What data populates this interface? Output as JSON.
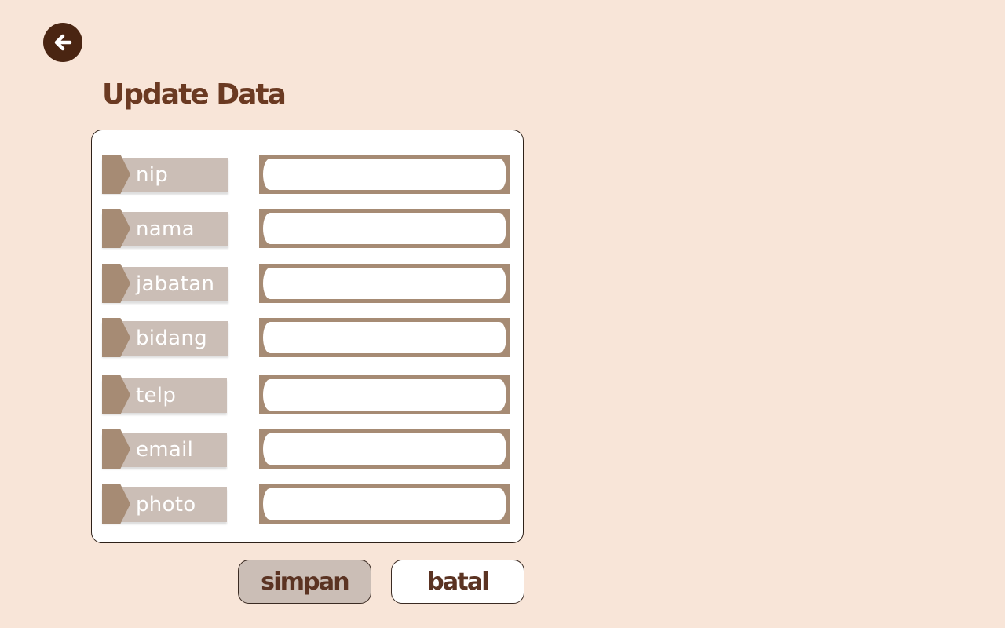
{
  "header": {
    "back_icon": "arrow-left-icon",
    "title": "Update Data"
  },
  "form": {
    "fields": [
      {
        "label": "nip",
        "value": ""
      },
      {
        "label": "nama",
        "value": ""
      },
      {
        "label": "jabatan",
        "value": ""
      },
      {
        "label": "bidang",
        "value": ""
      },
      {
        "label": "telp",
        "value": ""
      },
      {
        "label": "email",
        "value": ""
      },
      {
        "label": "photo",
        "value": ""
      }
    ]
  },
  "actions": {
    "save_label": "simpan",
    "cancel_label": "batal"
  },
  "colors": {
    "background": "#f8e5d8",
    "accent_dark": "#4a2512",
    "title": "#6b3a22",
    "label_tag": "#cbbeb6",
    "label_notch": "#a68b74",
    "input_border": "#a68b74"
  }
}
